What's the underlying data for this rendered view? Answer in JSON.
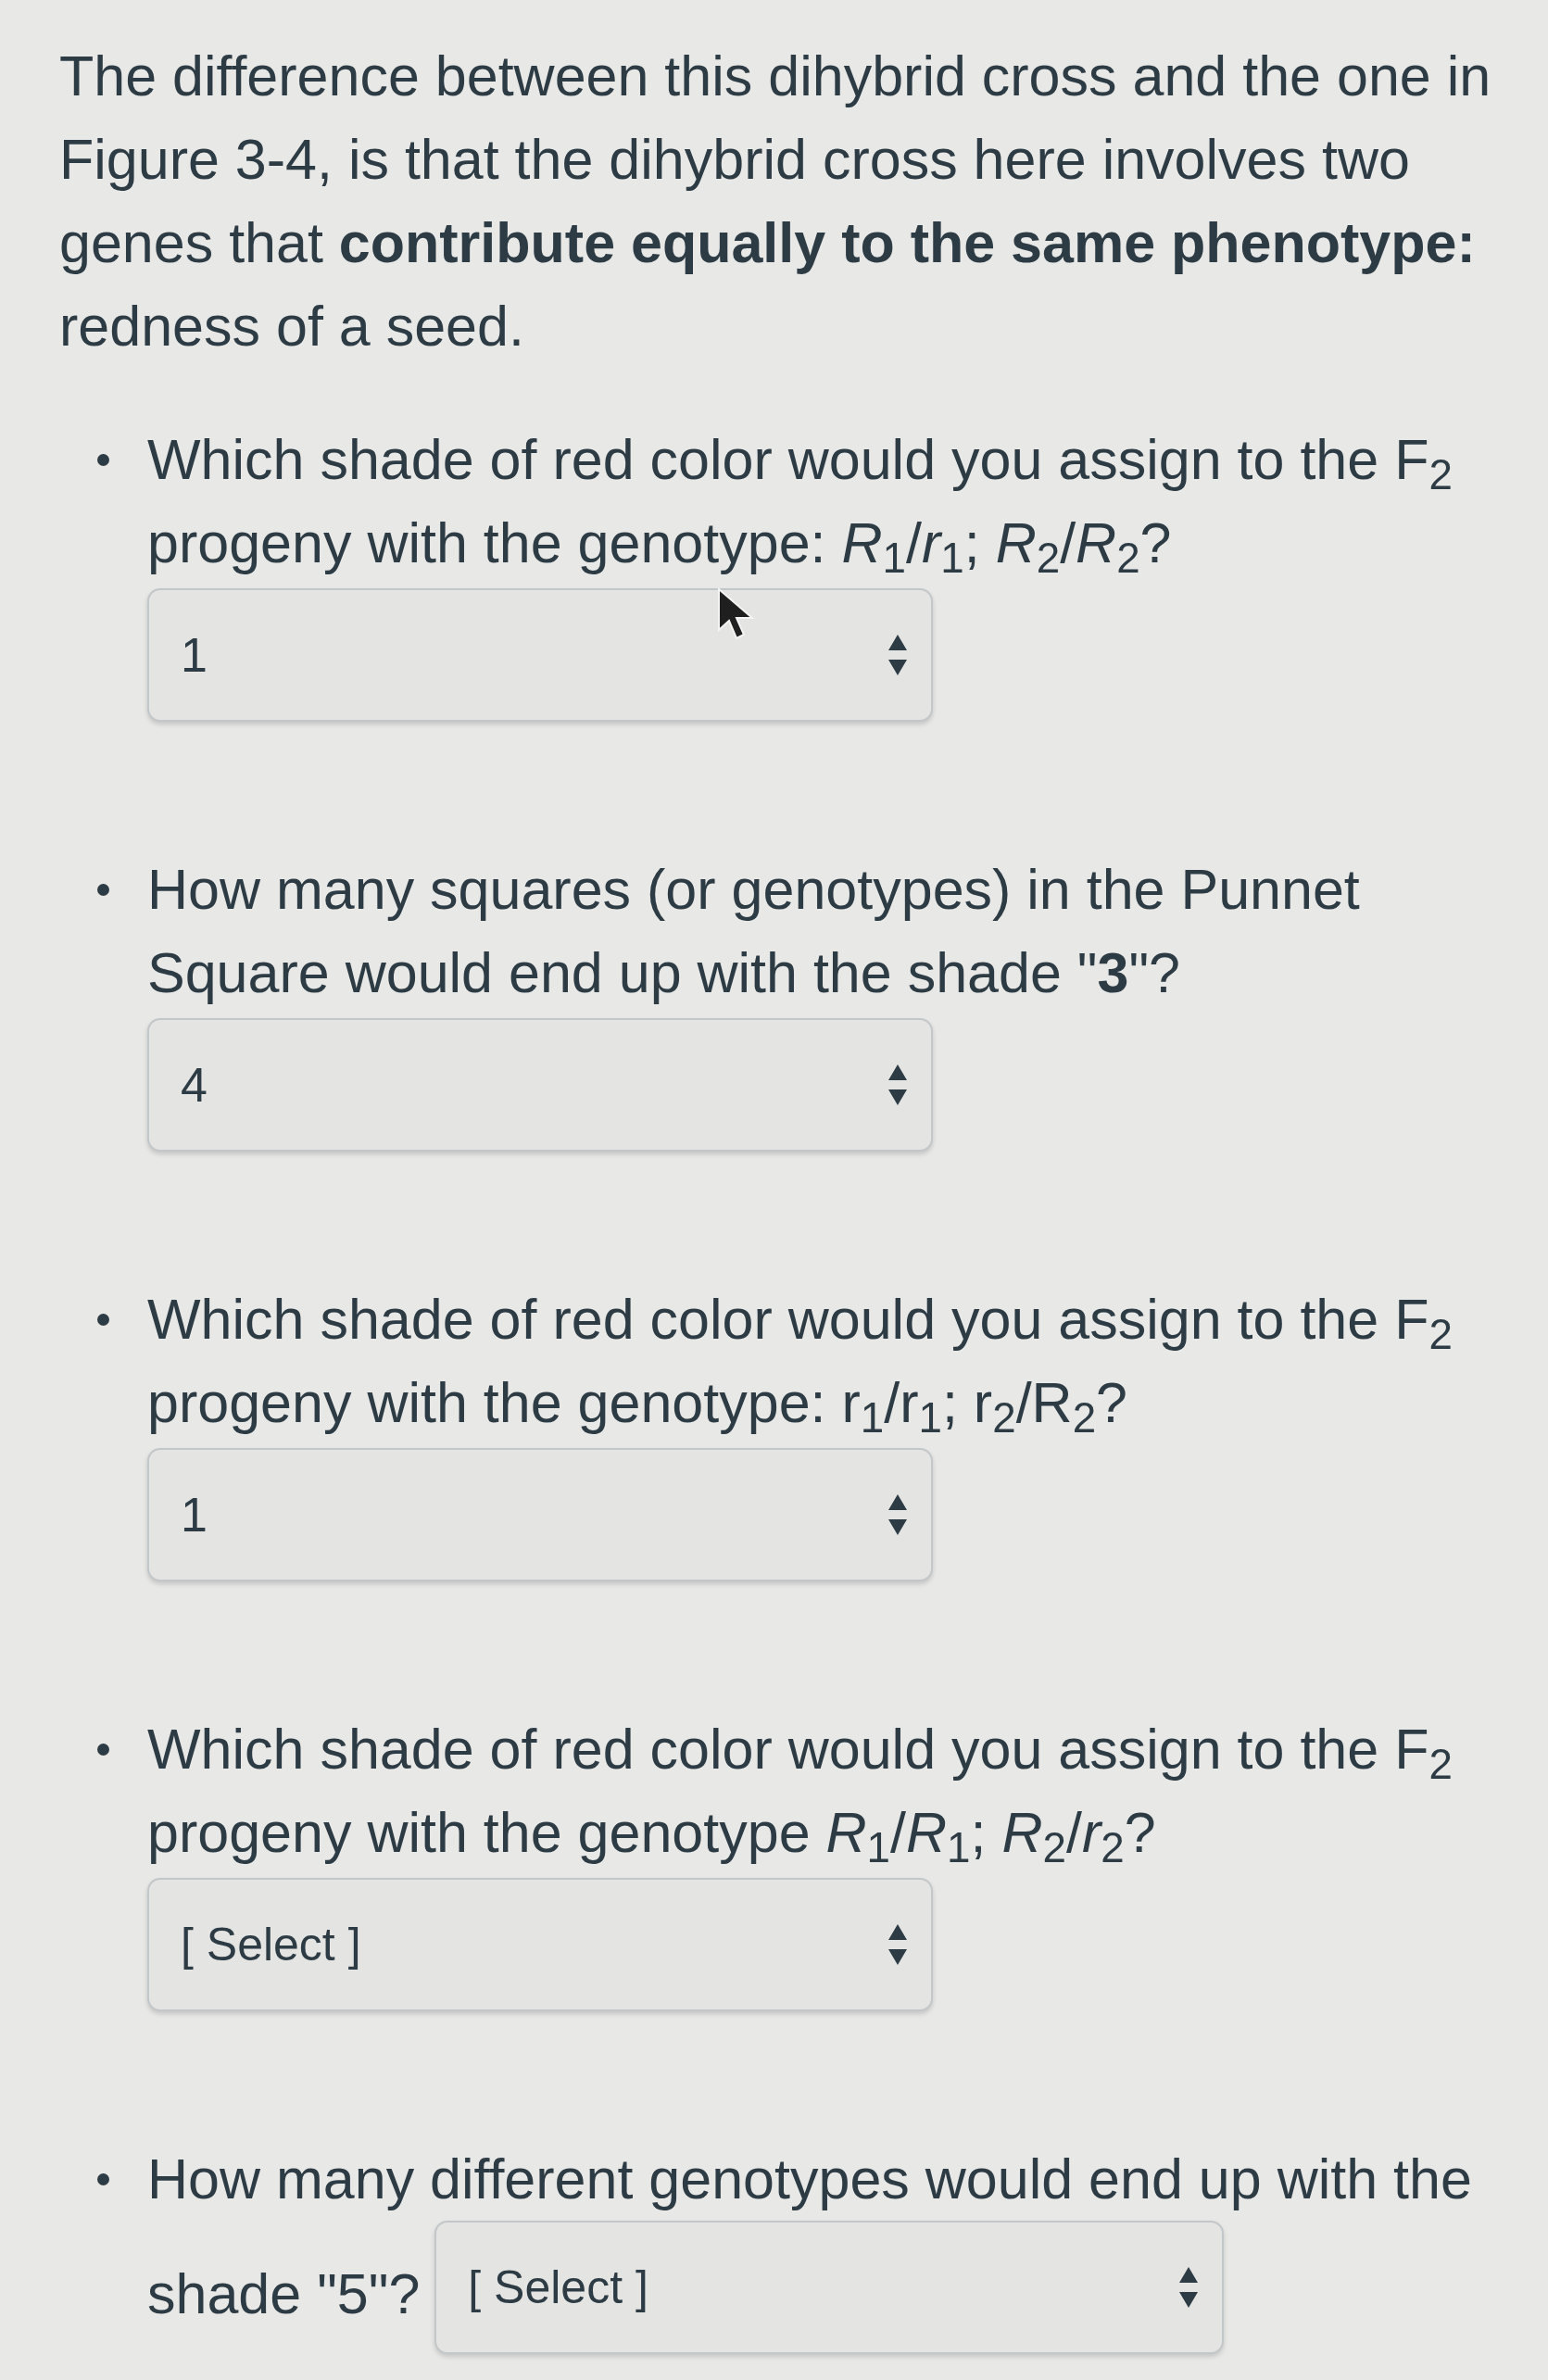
{
  "intro": "The difference between this dihybrid cross and the one in Figure 3-4, is that the dihybrid cross here involves two genes that **contribute equally to the same phenotype:** redness of a seed.",
  "questions": [
    {
      "kind": "block",
      "text": "Which shade of red color would you assign to the F$_{2}$ progeny with the genotype: *R*$_{1}$/*r*$_{1}$; *R*$_{2}$/*R*$_{2}$?",
      "select": {
        "value": "1"
      }
    },
    {
      "kind": "block",
      "text": "How many squares (or genotypes) in the Punnet Square would end up with the shade \"**3**\"?",
      "select": {
        "value": "4"
      }
    },
    {
      "kind": "block",
      "text": "Which shade of red color would you assign to the F$_{2}$ progeny with the genotype: r$_{1}$/r$_{1}$; r$_{2}$/R$_{2}$?",
      "select": {
        "value": "1"
      }
    },
    {
      "kind": "block",
      "text": "Which shade of red color would you assign to the F$_{2}$ progeny with the genotype *R*$_{1}$/*R*$_{1}$; *R*$_{2}$/*r*$_{2}$?",
      "select": {
        "placeholder": "[ Select ]"
      }
    },
    {
      "kind": "inline",
      "text": "How many different genotypes would end up with the",
      "select_label": "shade \"5\"?",
      "select": {
        "placeholder": "[ Select ]"
      }
    }
  ]
}
